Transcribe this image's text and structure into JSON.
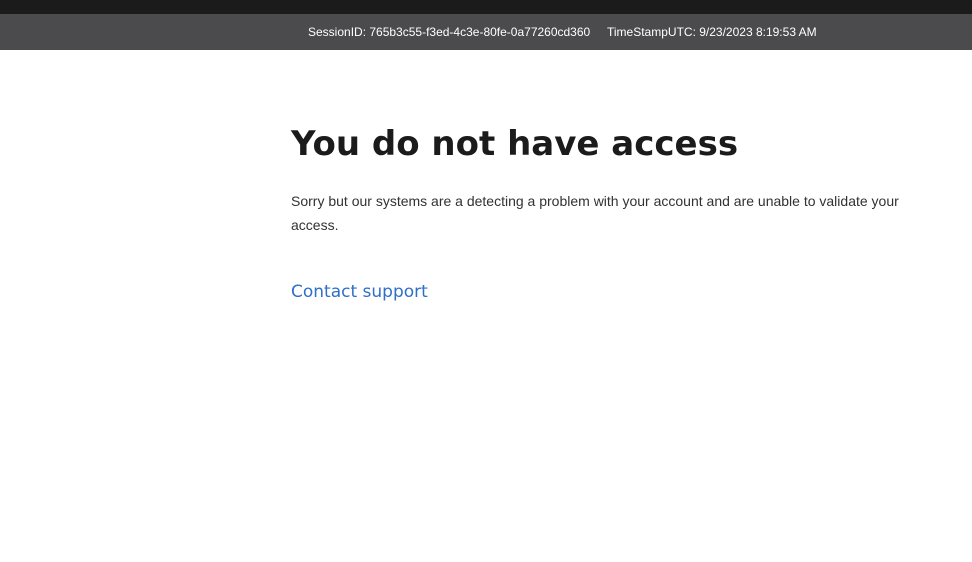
{
  "session_bar": {
    "session_id": "SessionID: 765b3c55-f3ed-4c3e-80fe-0a77260cd360",
    "timestamp": "TimeStampUTC: 9/23/2023 8:19:53 AM"
  },
  "main": {
    "title": "You do not have access",
    "message": "Sorry but our systems are a detecting a problem with your account and are unable to validate your access.",
    "contact_link": "Contact support"
  },
  "colors": {
    "top_strip": "#1b1b1b",
    "session_bar": "#4b4b4d",
    "link": "#2f6fc7",
    "title": "#1b1b1b"
  }
}
